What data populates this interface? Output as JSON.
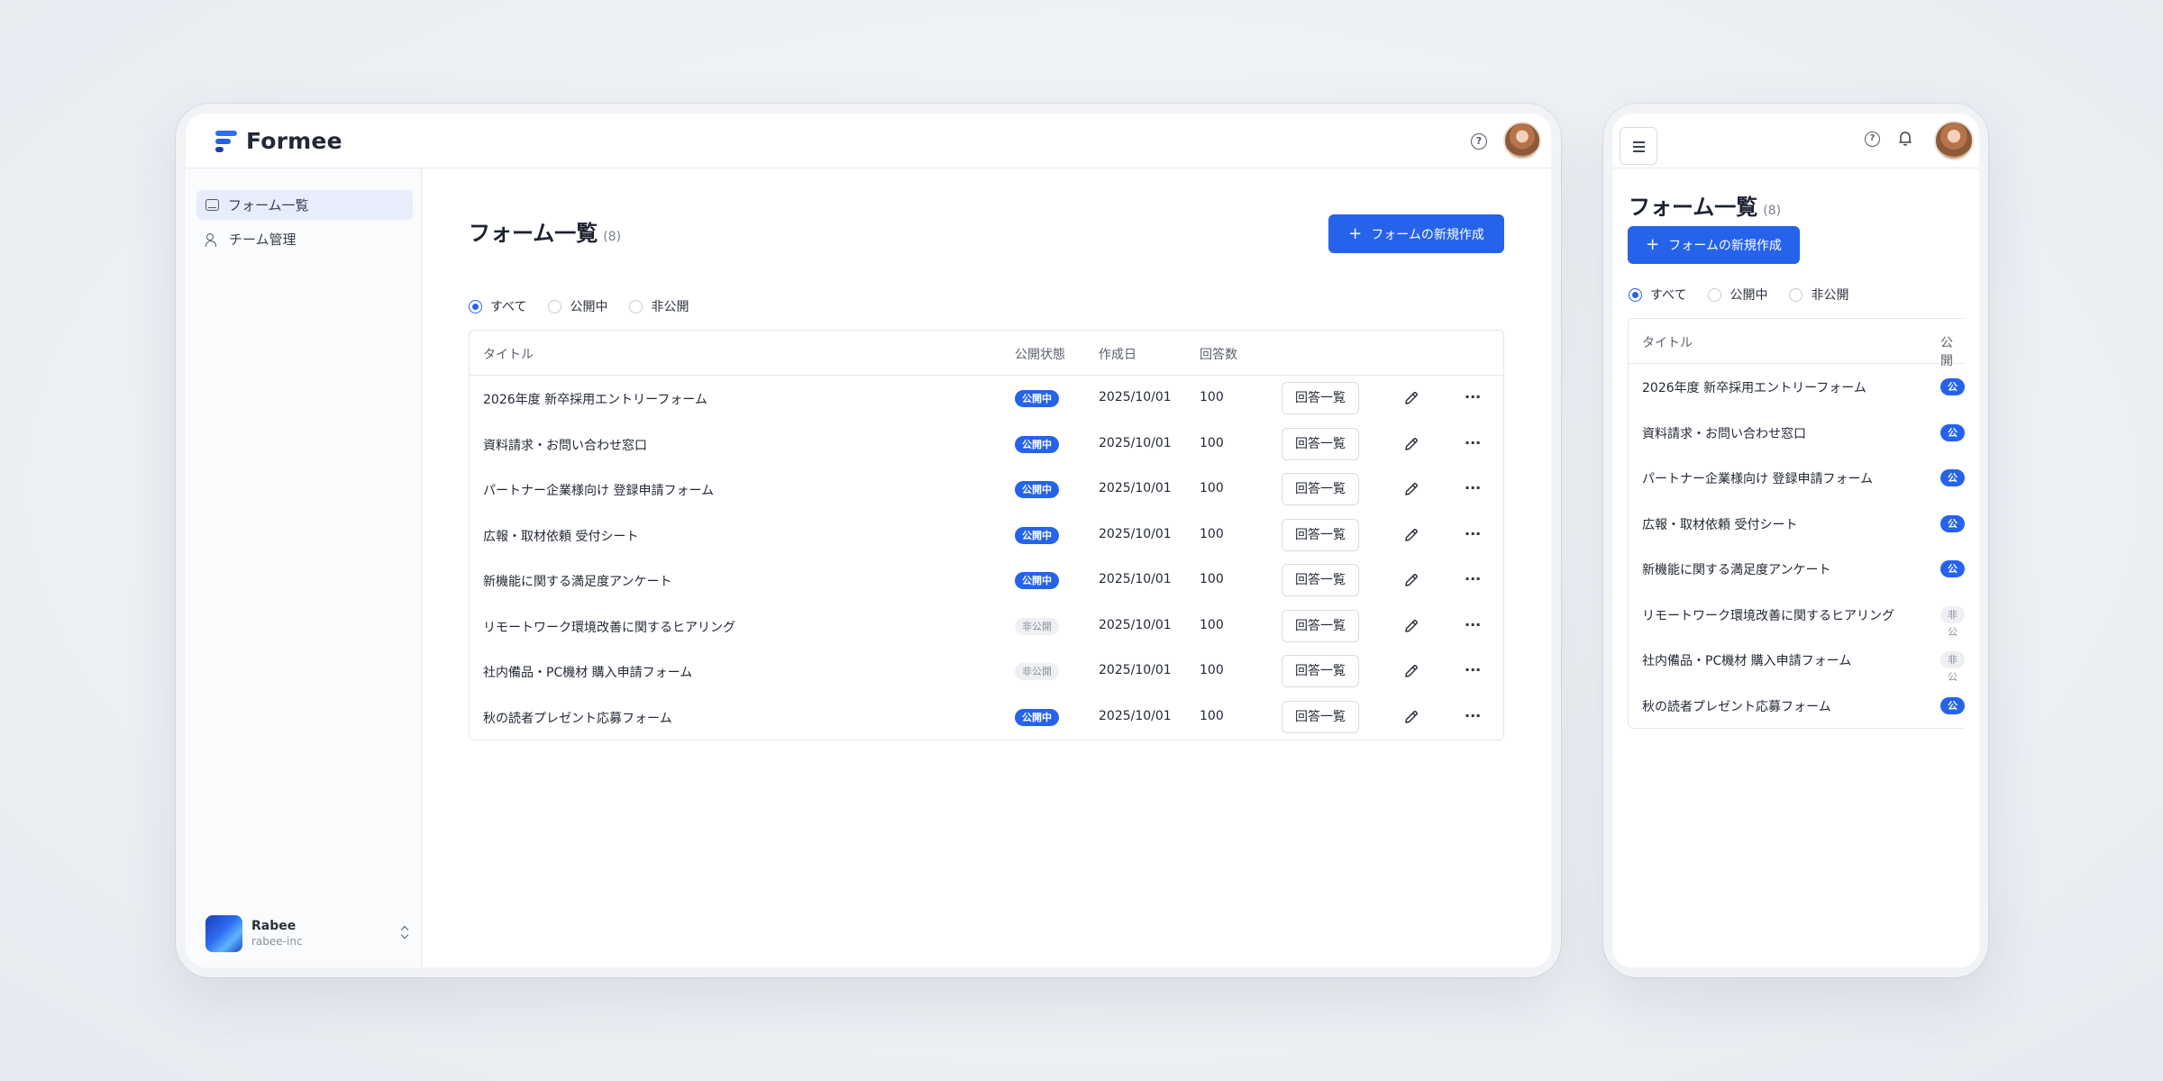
{
  "app": {
    "brand": "Formee"
  },
  "header": {
    "help_icon": "help-circle-icon",
    "notification_icon": "bell-icon",
    "menu_icon": "hamburger-menu-icon"
  },
  "sidebar": {
    "items": [
      {
        "label": "フォーム一覧",
        "icon": "inbox-icon",
        "active": true
      },
      {
        "label": "チーム管理",
        "icon": "users-icon",
        "active": false
      }
    ],
    "org": {
      "name": "Rabee",
      "slug": "rabee-inc"
    }
  },
  "page": {
    "title": "フォーム一覧",
    "count": "(8)",
    "new_button": "フォームの新規作成"
  },
  "filters": [
    "すべて",
    "公開中",
    "非公開"
  ],
  "filter_selected": "すべて",
  "table": {
    "headers": {
      "title": "タイトル",
      "status": "公開状態",
      "created": "作成日",
      "responses": "回答数"
    },
    "mobile_status_header": "公開",
    "action_label": "回答一覧",
    "rows": [
      {
        "title": "2026年度 新卒採用エントリーフォーム",
        "status": "公開中",
        "public": true,
        "date": "2025/10/01",
        "count": "100",
        "mobile_badge": "公開"
      },
      {
        "title": "資料請求・お問い合わせ窓口",
        "status": "公開中",
        "public": true,
        "date": "2025/10/01",
        "count": "100",
        "mobile_badge": "公開"
      },
      {
        "title": "パートナー企業様向け 登録申請フォーム",
        "status": "公開中",
        "public": true,
        "date": "2025/10/01",
        "count": "100",
        "mobile_badge": "公開"
      },
      {
        "title": "広報・取材依頼 受付シート",
        "status": "公開中",
        "public": true,
        "date": "2025/10/01",
        "count": "100",
        "mobile_badge": "公開"
      },
      {
        "title": "新機能に関する満足度アンケート",
        "status": "公開中",
        "public": true,
        "date": "2025/10/01",
        "count": "100",
        "mobile_badge": "公開"
      },
      {
        "title": "リモートワーク環境改善に関するヒアリング",
        "status": "非公開",
        "public": false,
        "date": "2025/10/01",
        "count": "100",
        "mobile_badge": "非公"
      },
      {
        "title": "社内備品・PC機材 購入申請フォーム",
        "status": "非公開",
        "public": false,
        "date": "2025/10/01",
        "count": "100",
        "mobile_badge": "非公"
      },
      {
        "title": "秋の読者プレゼント応募フォーム",
        "status": "公開中",
        "public": true,
        "date": "2025/10/01",
        "count": "100",
        "mobile_badge": "公開"
      }
    ]
  },
  "colors": {
    "accent": "#2563eb",
    "badge_private_bg": "#eef0f3"
  }
}
